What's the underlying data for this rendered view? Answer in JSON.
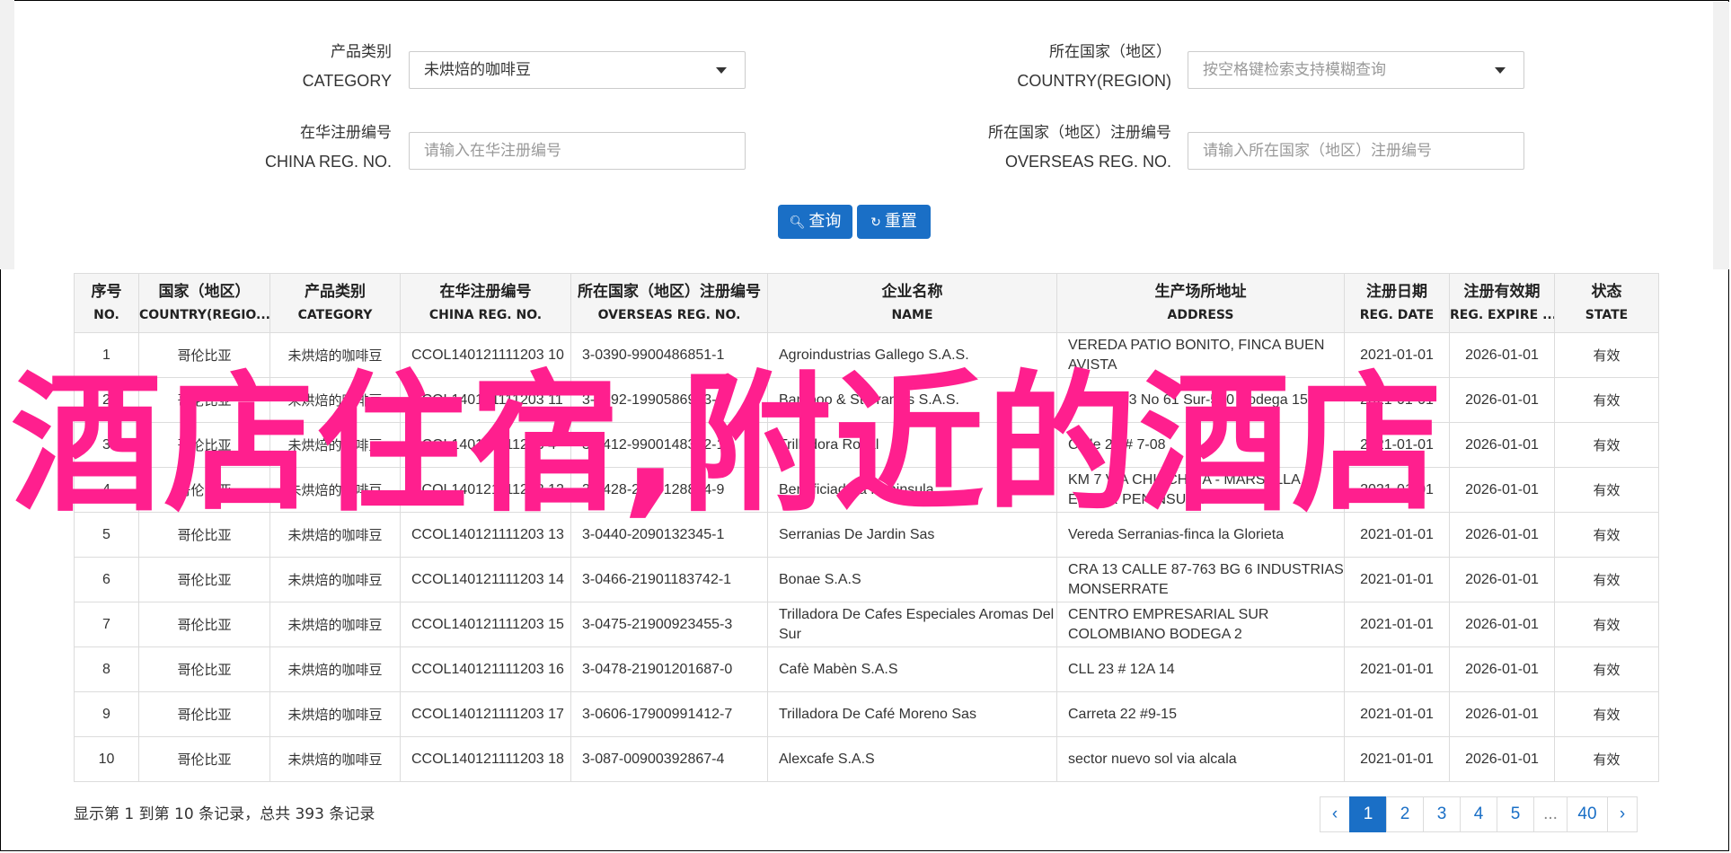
{
  "filters": {
    "category": {
      "label_zh": "产品类别",
      "label_en": "CATEGORY",
      "value": "未烘焙的咖啡豆"
    },
    "country": {
      "label_zh": "所在国家（地区）",
      "label_en": "COUNTRY(REGION)",
      "placeholder": "按空格键检索支持模糊查询"
    },
    "china_reg": {
      "label_zh": "在华注册编号",
      "label_en": "CHINA REG. NO.",
      "placeholder": "请输入在华注册编号"
    },
    "overseas_reg": {
      "label_zh": "所在国家（地区）注册编号",
      "label_en": "OVERSEAS REG. NO.",
      "placeholder": "请输入所在国家（地区）注册编号"
    },
    "search_label": "查询",
    "reset_label": "重置"
  },
  "table": {
    "columns": [
      {
        "zh": "序号",
        "en": "NO."
      },
      {
        "zh": "国家（地区）",
        "en": "COUNTRY(REGIO..."
      },
      {
        "zh": "产品类别",
        "en": "CATEGORY"
      },
      {
        "zh": "在华注册编号",
        "en": "CHINA REG. NO."
      },
      {
        "zh": "所在国家（地区）注册编号",
        "en": "OVERSEAS REG. NO."
      },
      {
        "zh": "企业名称",
        "en": "NAME"
      },
      {
        "zh": "生产场所地址",
        "en": "ADDRESS"
      },
      {
        "zh": "注册日期",
        "en": "REG. DATE"
      },
      {
        "zh": "注册有效期",
        "en": "REG. EXPIRE ..."
      },
      {
        "zh": "状态",
        "en": "STATE"
      }
    ],
    "rows": [
      [
        "1",
        "哥伦比亚",
        "未烘焙的咖啡豆",
        "CCOL140121111203 10",
        "3-0390-9900486851-1",
        "Agroindustrias Gallego S.A.S.",
        "VEREDA PATIO BONITO, FINCA BUEN AVISTA",
        "2021-01-01",
        "2026-01-01",
        "有效"
      ],
      [
        "2",
        "哥伦比亚",
        "未烘焙的咖啡豆",
        "CCOL140121111203 11",
        "3-0392-1990586973-0",
        "Bamboo & St Francis S.A.S.",
        "Carrera 43 No 61 Sur-540 Bodega 15",
        "2021-01-01",
        "2026-01-01",
        "有效"
      ],
      [
        "3",
        "哥伦比亚",
        "未烘焙的咖啡豆",
        "CCOL140121111203 4",
        "3-0412-9900148312-1",
        "Trilladora Royal",
        "Calle 25 # 7-08",
        "2021-01-01",
        "2026-01-01",
        "有效"
      ],
      [
        "4",
        "哥伦比亚",
        "未烘焙的咖啡豆",
        "CCOL140121111203 12",
        "3-0428-2090128884-9",
        "Beneficiadora Peninsula",
        "KM 7 VIA CHINCHINA - MARSELLA, ECTOR PENINSULA",
        "2021-01-01",
        "2026-01-01",
        "有效"
      ],
      [
        "5",
        "哥伦比亚",
        "未烘焙的咖啡豆",
        "CCOL140121111203 13",
        "3-0440-2090132345-1",
        "Serranias De Jardin Sas",
        "Vereda Serranias-finca la Glorieta",
        "2021-01-01",
        "2026-01-01",
        "有效"
      ],
      [
        "6",
        "哥伦比亚",
        "未烘焙的咖啡豆",
        "CCOL140121111203 14",
        "3-0466-21901183742-1",
        "Bonae S.A.S",
        "CRA 13 CALLE 87-763 BG 6 INDUSTRIAS MONSERRATE",
        "2021-01-01",
        "2026-01-01",
        "有效"
      ],
      [
        "7",
        "哥伦比亚",
        "未烘焙的咖啡豆",
        "CCOL140121111203 15",
        "3-0475-21900923455-3",
        "Trilladora De Cafes Especiales Aromas Del Sur",
        "CENTRO EMPRESARIAL SUR COLOMBIANO BODEGA 2",
        "2021-01-01",
        "2026-01-01",
        "有效"
      ],
      [
        "8",
        "哥伦比亚",
        "未烘焙的咖啡豆",
        "CCOL140121111203 16",
        "3-0478-21901201687-0",
        "Cafè Mabèn S.A.S",
        "CLL 23 # 12A 14",
        "2021-01-01",
        "2026-01-01",
        "有效"
      ],
      [
        "9",
        "哥伦比亚",
        "未烘焙的咖啡豆",
        "CCOL140121111203 17",
        "3-0606-17900991412-7",
        "Trilladora De Café Moreno Sas",
        "Carreta 22 #9-15",
        "2021-01-01",
        "2026-01-01",
        "有效"
      ],
      [
        "10",
        "哥伦比亚",
        "未烘焙的咖啡豆",
        "CCOL140121111203 18",
        "3-087-00900392867-4",
        "Alexcafe S.A.S",
        "sector nuevo sol via alcala",
        "2021-01-01",
        "2026-01-01",
        "有效"
      ]
    ]
  },
  "footer": {
    "info": "显示第 1 到第 10 条记录，总共 393 条记录",
    "pager": [
      "‹",
      "1",
      "2",
      "3",
      "4",
      "5",
      "...",
      "40",
      "›"
    ],
    "active_page": "1"
  },
  "overlay_text": "酒店住宿,附近的酒店",
  "colors": {
    "primary": "#1a6fc6",
    "overlay": "#ff1f8e"
  }
}
